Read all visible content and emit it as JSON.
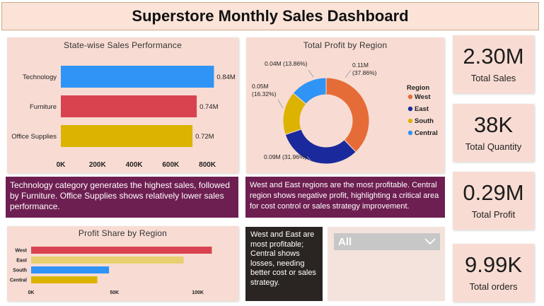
{
  "header": {
    "title": "Superstore Monthly Sales Dashboard"
  },
  "kpis": {
    "total_sales": {
      "value": "2.30M",
      "label": "Total Sales"
    },
    "total_quantity": {
      "value": "38K",
      "label": "Total Quantity"
    },
    "total_profit": {
      "value": "0.29M",
      "label": "Total Profit"
    },
    "total_orders": {
      "value": "9.99K",
      "label": "Total orders"
    }
  },
  "notes": {
    "category": "Technology category generates the highest sales, followed by Furniture. Office Supplies shows relatively lower sales performance.",
    "region": "West and East regions are the most profitable. Central region shows negative profit, highlighting a critical area for cost control or sales strategy improvement.",
    "profit_share": "West and East are most profitable; Central shows losses, needing better cost or sales strategy."
  },
  "slicer": {
    "value": "All",
    "icon": "chevron-down-icon"
  },
  "chart_data": [
    {
      "type": "bar",
      "orientation": "horizontal",
      "title": "State-wise Sales Performance",
      "categories": [
        "Technology",
        "Furniture",
        "Office Supplies"
      ],
      "values": [
        836000,
        742000,
        719000
      ],
      "data_labels": [
        "0.84M",
        "0.74M",
        "0.72M"
      ],
      "colors": [
        "#2f94f5",
        "#d9434f",
        "#dcb300"
      ],
      "xlim": [
        0,
        900000
      ],
      "xticks": [
        0,
        200000,
        400000,
        600000,
        800000
      ],
      "xtick_labels": [
        "0K",
        "200K",
        "400K",
        "600K",
        "800K"
      ],
      "grid": false
    },
    {
      "type": "pie",
      "donut": true,
      "title": "Total Profit by Region",
      "legend_title": "Region",
      "legend_position": "right",
      "categories": [
        "West",
        "East",
        "South",
        "Central"
      ],
      "values": [
        108418,
        91523,
        46749,
        39706
      ],
      "percents": [
        37.86,
        31.96,
        16.32,
        13.86
      ],
      "data_labels": [
        "0.11M\n(37.86%)",
        "0.09M (31.96%)",
        "0.05M\n(16.32%)",
        "0.04M (13.86%)"
      ],
      "colors": [
        "#e66c37",
        "#1a2a9c",
        "#dcb300",
        "#2f94f5"
      ]
    },
    {
      "type": "bar",
      "orientation": "horizontal",
      "title": "Profit Share by Region",
      "categories": [
        "West",
        "East",
        "South",
        "Central"
      ],
      "values": [
        108418,
        91523,
        46749,
        39706
      ],
      "colors": [
        "#d9434f",
        "#e8d070",
        "#2f94f5",
        "#dcb300"
      ],
      "xlim": [
        0,
        118000
      ],
      "xticks": [
        0,
        50000,
        100000
      ],
      "xtick_labels": [
        "0K",
        "50K",
        "100K"
      ],
      "grid": false
    }
  ]
}
